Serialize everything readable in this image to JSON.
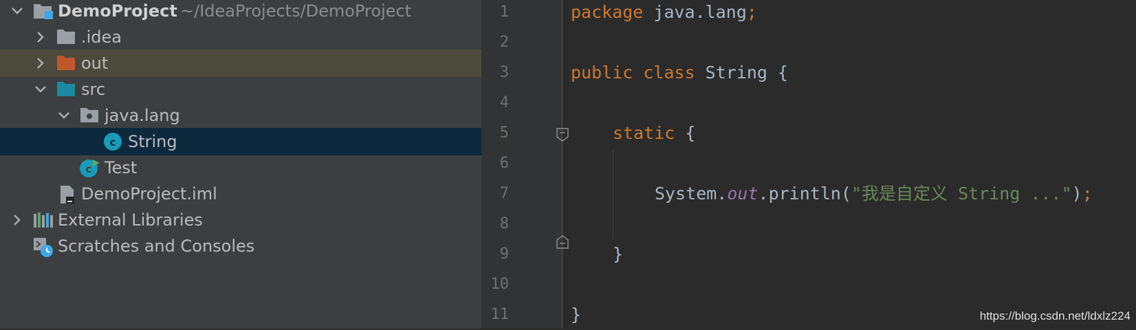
{
  "project_tree": {
    "root": {
      "name": "DemoProject",
      "path": "~/IdeaProjects/DemoProject"
    },
    "items": [
      {
        "label": ".idea"
      },
      {
        "label": "out"
      },
      {
        "label": "src"
      },
      {
        "label": "java.lang"
      },
      {
        "label": "String"
      },
      {
        "label": "Test"
      },
      {
        "label": "DemoProject.iml"
      },
      {
        "label": "External Libraries"
      },
      {
        "label": "Scratches and Consoles"
      }
    ],
    "selected": "String",
    "highlighted": "out"
  },
  "editor": {
    "line_numbers": [
      "1",
      "2",
      "3",
      "4",
      "5",
      "6",
      "7",
      "8",
      "9",
      "10",
      "11"
    ],
    "code": {
      "l1_kw": "package",
      "l1_name": " java.lang",
      "l1_semi": ";",
      "l3_kw1": "public",
      "l3_kw2": " class",
      "l3_rest": " String {",
      "l5_kw": "static",
      "l5_rest": " {",
      "l7_a": "System.",
      "l7_field": "out",
      "l7_b": ".println(",
      "l7_str": "\"我是自定义 String ...\"",
      "l7_c": ")",
      "l7_semi": ";",
      "l9": "}",
      "l11": "}"
    }
  },
  "watermark": "https://blog.csdn.net/ldxlz224",
  "colors": {
    "keyword": "#cc7832",
    "string": "#6a8759",
    "field": "#9876aa",
    "selection": "#0d293e",
    "highlight": "#4b4a3d",
    "folder_excluded": "#c0582b",
    "folder_source": "#1b8aa0"
  }
}
